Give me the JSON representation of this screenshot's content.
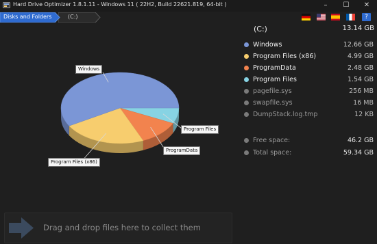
{
  "window": {
    "title": "Hard Drive Optimizer 1.8.1.11 - Windows 11 ( 22H2, Build 22621.819, 64-bit )",
    "controls": {
      "minimize": "–",
      "maximize": "☐",
      "close": "✕"
    }
  },
  "breadcrumb": {
    "items": [
      "Disks and Folders",
      "(C:)"
    ]
  },
  "languages": [
    "German",
    "English",
    "Spanish",
    "French",
    "Help"
  ],
  "help_label": "?",
  "drive": {
    "name": "(C:)",
    "size": "13.14 GB"
  },
  "items": [
    {
      "name": "Windows",
      "size": "12.66 GB",
      "color": "#7b96d6"
    },
    {
      "name": "Program Files (x86)",
      "size": "4.99 GB",
      "color": "#f7cd6e"
    },
    {
      "name": "ProgramData",
      "size": "2.48 GB",
      "color": "#f2834e"
    },
    {
      "name": "Program Files",
      "size": "1.54 GB",
      "color": "#87d3e3"
    },
    {
      "name": "pagefile.sys",
      "size": "256 MB",
      "color": "#7a7a7a"
    },
    {
      "name": "swapfile.sys",
      "size": "16 MB",
      "color": "#7a7a7a"
    },
    {
      "name": "DumpStack.log.tmp",
      "size": "12 KB",
      "color": "#7a7a7a"
    }
  ],
  "space": [
    {
      "name": "Free space:",
      "size": "46.2 GB"
    },
    {
      "name": "Total space:",
      "size": "59.34 GB"
    }
  ],
  "chart_data": {
    "type": "pie",
    "labels": [
      "Windows",
      "Program Files (x86)",
      "ProgramData",
      "Program Files"
    ],
    "values": [
      12.66,
      4.99,
      2.48,
      1.54
    ],
    "colors": [
      "#7b96d6",
      "#f7cd6e",
      "#f2834e",
      "#87d3e3"
    ]
  },
  "dropzone": {
    "text": "Drag and drop files here to collect them"
  }
}
